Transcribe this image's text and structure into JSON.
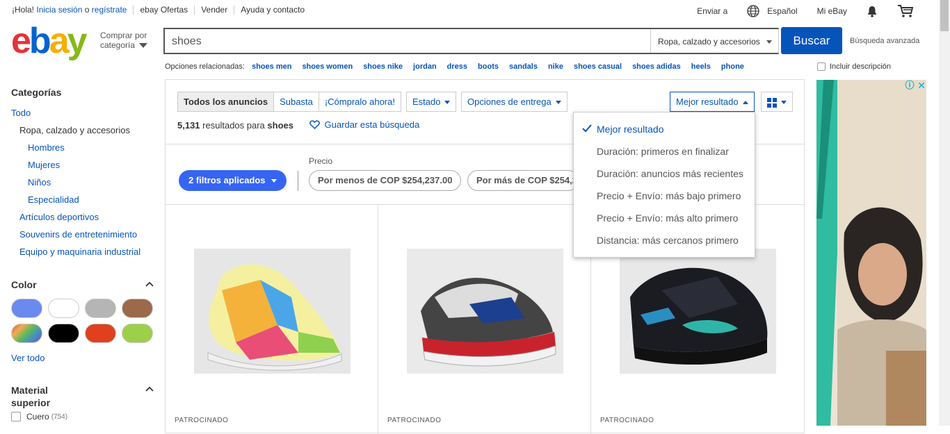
{
  "topbar": {
    "greeting": "¡Hola!",
    "signin": "Inicia sesión",
    "or": "o",
    "register": "regístrate",
    "offers": "ebay Ofertas",
    "sell": "Vender",
    "help": "Ayuda y contacto",
    "ship_to": "Enviar a",
    "language": "Español",
    "my_ebay": "Mi eBay"
  },
  "header": {
    "shop_by_1": "Comprar por",
    "shop_by_2": "categoría",
    "search_value": "shoes",
    "category_select": "Ropa, calzado y accesorios",
    "search_button": "Buscar",
    "advanced": "Búsqueda avanzada"
  },
  "related": {
    "label": "Opciones relacionadas:",
    "items": [
      "shoes men",
      "shoes women",
      "shoes nike",
      "jordan",
      "dress",
      "boots",
      "sandals",
      "nike",
      "shoes casual",
      "shoes adidas",
      "heels",
      "phone"
    ],
    "include_description": "Incluir descripción"
  },
  "sidebar": {
    "categories_title": "Categorías",
    "all": "Todo",
    "current": "Ropa, calzado y accesorios",
    "sub": [
      "Hombres",
      "Mujeres",
      "Niños",
      "Especialidad"
    ],
    "other": [
      "Artículos deportivos",
      "Souvenirs de entretenimiento",
      "Equipo y maquinaria industrial"
    ],
    "color_title": "Color",
    "colors": [
      "#6b8af0",
      "#ffffff",
      "#b5b5b5",
      "#9b6a4a",
      "multicolor",
      "#000000",
      "#e0401e",
      "#9ccf4a"
    ],
    "see_all": "Ver todo",
    "material_title_1": "Material",
    "material_title_2": "superior",
    "material_first": "Cuero",
    "material_first_count": "(754)"
  },
  "toolbar": {
    "tabs": [
      "Todos los anuncios",
      "Subasta",
      "¡Cómpralo ahora!"
    ],
    "estado": "Estado",
    "delivery": "Opciones de entrega",
    "sort": "Mejor resultado"
  },
  "results": {
    "count": "5,131",
    "for_text": "resultados para",
    "query": "shoes",
    "save_search": "Guardar esta búsqueda"
  },
  "filters": {
    "price_label": "Precio",
    "applied": "2 filtros aplicados",
    "under": "Por menos de COP $254,237.00",
    "over": "Por más de COP $254,237.00"
  },
  "sort_menu": [
    "Mejor resultado",
    "Duración: primeros en finalizar",
    "Duración: anuncios más recientes",
    "Precio + Envío: más bajo primero",
    "Precio + Envío: más alto primero",
    "Distancia: más cercanos primero"
  ],
  "items": [
    {
      "label": "PATROCINADO"
    },
    {
      "label": "PATROCINADO"
    },
    {
      "label": "PATROCINADO"
    }
  ]
}
